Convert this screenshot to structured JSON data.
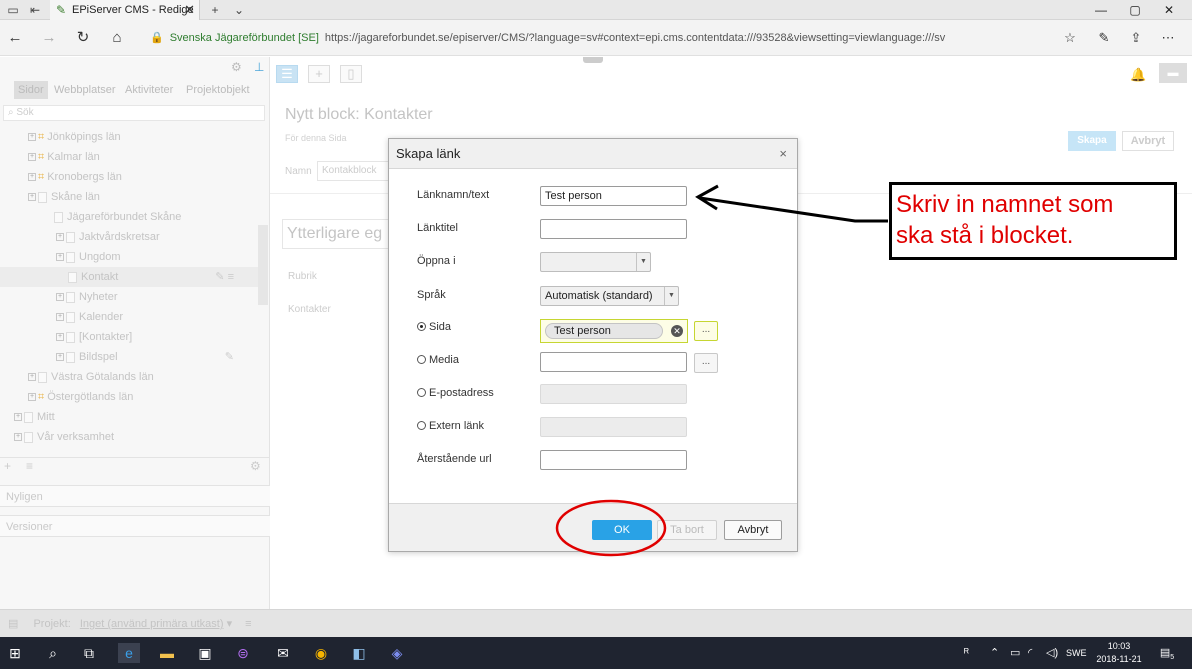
{
  "browser": {
    "tab_title": "EPiServer CMS - Redige",
    "site_name": "Svenska Jägareförbundet [SE]",
    "url": "https://jagareforbundet.se/episerver/CMS/?language=sv#context=epi.cms.contentdata:///93528&viewsetting=viewlanguage:///sv"
  },
  "left_pane": {
    "tabs": [
      "Sidor",
      "Webbplatser",
      "Aktiviteter",
      "Projektobjekt"
    ],
    "search_placeholder": "Sök",
    "tree": [
      {
        "label": "Jönköpings län",
        "indent": 1,
        "icon": "star"
      },
      {
        "label": "Kalmar län",
        "indent": 1,
        "icon": "star"
      },
      {
        "label": "Kronobergs län",
        "indent": 1,
        "icon": "star"
      },
      {
        "label": "Skåne län",
        "indent": 1,
        "icon": "page"
      },
      {
        "label": "Jägareförbundet Skåne",
        "indent": 2,
        "icon": "page"
      },
      {
        "label": "Jaktvårdskretsar",
        "indent": 3,
        "icon": "page"
      },
      {
        "label": "Ungdom",
        "indent": 3,
        "icon": "page"
      },
      {
        "label": "Kontakt",
        "indent": 3,
        "icon": "page",
        "selected": true
      },
      {
        "label": "Nyheter",
        "indent": 3,
        "icon": "page"
      },
      {
        "label": "Kalender",
        "indent": 3,
        "icon": "page"
      },
      {
        "label": "[Kontakter]",
        "indent": 3,
        "icon": "page"
      },
      {
        "label": "Bildspel",
        "indent": 3,
        "icon": "page"
      },
      {
        "label": "Västra Götalands län",
        "indent": 1,
        "icon": "page"
      },
      {
        "label": "Östergötlands län",
        "indent": 1,
        "icon": "star"
      },
      {
        "label": "Mitt",
        "indent": 0,
        "icon": "page"
      },
      {
        "label": "Vår verksamhet",
        "indent": 0,
        "icon": "page"
      }
    ],
    "nyligen": "Nyligen",
    "versioner": "Versioner"
  },
  "main": {
    "title": "Nytt block: Kontakter",
    "subtitle": "För denna Sida",
    "name_label": "Namn",
    "name_value": "Kontakblock",
    "create_button": "Skapa",
    "cancel_button": "Avbryt",
    "section_heading": "Ytterligare eg",
    "field_rubrik": "Rubrik",
    "field_kontakter": "Kontakter"
  },
  "status_bar": {
    "project_label": "Projekt:",
    "project_value": "Inget (använd primära utkast)"
  },
  "dialog": {
    "title": "Skapa länk",
    "close": "×",
    "link_name_label": "Länknamn/text",
    "link_name_value": "Test person",
    "link_title_label": "Länktitel",
    "link_title_value": "",
    "open_in_label": "Öppna i",
    "open_in_value": "",
    "language_label": "Språk",
    "language_value": "Automatisk (standard)",
    "page_label": "Sida",
    "page_value": "Test person",
    "media_label": "Media",
    "email_label": "E-postadress",
    "external_label": "Extern länk",
    "remaining_url_label": "Återstående url",
    "browse": "...",
    "ok_button": "OK",
    "remove_button": "Ta bort",
    "cancel_button": "Avbryt"
  },
  "annotation": {
    "line1": "Skriv in namnet som",
    "line2": "ska stå i blocket.",
    "color": "#e00000"
  },
  "taskbar": {
    "language": "SWE",
    "time": "10:03",
    "date": "2018-11-21",
    "notifications": "5"
  }
}
